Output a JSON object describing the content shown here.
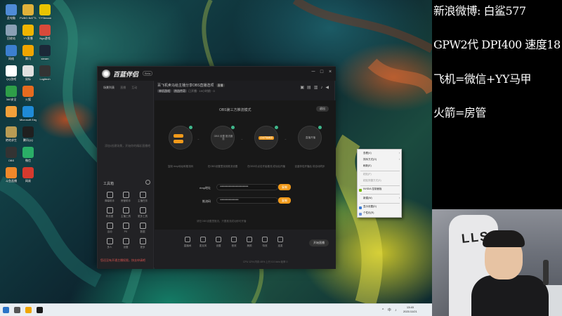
{
  "desktop_icons": [
    {
      "label": "此电脑",
      "color": "#4f8bd6"
    },
    {
      "label": "PUBG BATTLEGR",
      "color": "#e0b13a"
    },
    {
      "label": "YYStream",
      "color": "#e8c400"
    },
    {
      "label": "回收站",
      "color": "#8aa0b5"
    },
    {
      "label": "YY直播",
      "color": "#f0b400"
    },
    {
      "label": "Ngo游戏",
      "color": "#d84a3a"
    },
    {
      "label": "网络",
      "color": "#3c7fd0"
    },
    {
      "label": "腾讯",
      "color": "#f0a500"
    },
    {
      "label": "steam",
      "color": "#1b2838"
    },
    {
      "label": "QQ游戏",
      "color": "#ffffff"
    },
    {
      "label": "鼠标",
      "color": "#e0e0e0"
    },
    {
      "label": "Logitech",
      "color": "#333333"
    },
    {
      "label": "360安全",
      "color": "#2e9e48"
    },
    {
      "label": "火狐",
      "color": "#e66b1f"
    },
    {
      "label": "",
      "color": "#f2a03a"
    },
    {
      "label": "Microsoft Edge",
      "color": "#1f8ad6"
    },
    {
      "label": "绝地求生",
      "color": "#b89b54"
    },
    {
      "label": "腾讯QQ",
      "color": "#1f1f1f"
    },
    {
      "label": "OBS",
      "color": "#333333"
    },
    {
      "label": "微信",
      "color": "#2aae67"
    },
    {
      "label": "斗鱼直播",
      "color": "#f0882a"
    },
    {
      "label": "网易",
      "color": "#d63a2e"
    }
  ],
  "app": {
    "title": "百蓝伴侣",
    "badge": "Beta",
    "window_controls": [
      "─",
      "□",
      "×"
    ],
    "sidebar_tabs": [
      "场景列表",
      "直播",
      "互动"
    ],
    "sidebar_empty": "添加/创建场景，开始你的精彩直播吧",
    "tools_title": "工具箱",
    "tools": [
      {
        "label": "弹幕助手"
      },
      {
        "label": "房管助手"
      },
      {
        "label": "主播任务"
      },
      {
        "label": "粉丝团"
      },
      {
        "label": "主播工具"
      },
      {
        "label": "更多工具"
      },
      {
        "label": "活动"
      },
      {
        "label": "PK"
      },
      {
        "label": "数据"
      },
      {
        "label": "多人"
      },
      {
        "label": "设置"
      },
      {
        "label": "更多"
      }
    ],
    "notice": "您还没有开通主播权限，快去申请吧",
    "main_title": "百飞机卖马给主播分享OBS直播选项",
    "main_tag": "直播",
    "main_chips": [
      "单机游戏",
      "热血传奇"
    ],
    "main_meta": "已开播 · 19小时前 · 0",
    "canvas_title": "OBS第三方推流模式",
    "exit_label": "退出",
    "steps": [
      {
        "text": "",
        "caption": "复制 rtmp地址和推流码"
      },
      {
        "text": "OBS 设置 推流服务",
        "caption": "在OBS设置里找到推流设置"
      },
      {
        "text": "点击开始推流",
        "caption": "在OBS中点击开始推流 成功后开播"
      },
      {
        "text": "直播开播",
        "caption": "百蓝伴侣开播后 将自动同步"
      }
    ],
    "rtmp_label": "rtmp地址",
    "rtmp_value": "••••••••••••••••••••••••••••••••",
    "key_label": "推流码",
    "key_value": "•••••••••••••••••••••",
    "copy_label": "复制",
    "canvas_note": "请在OBS设置里推流，只要推流成功即可开播",
    "bottom_items": [
      "直播间",
      "麦克风",
      "设置",
      "音效",
      "美颜",
      "特效",
      "连麦"
    ],
    "start_label": "开始直播",
    "status_line": "CPU 12%  内存 45%  上行 0.0 kb/s  帧率 0"
  },
  "context_menu": {
    "items": [
      {
        "label": "查看(V)",
        "arrow": true
      },
      {
        "label": "排序方式(O)",
        "arrow": true
      },
      {
        "label": "刷新(E)",
        "arrow": false
      },
      {
        "label": "粘贴(P)",
        "arrow": false
      },
      {
        "label": "粘贴快捷方式(S)",
        "arrow": false
      },
      {
        "label": "NVIDIA 控制面板",
        "arrow": false
      },
      {
        "label": "新建(W)",
        "arrow": true
      },
      {
        "label": "显示设置(D)",
        "arrow": false
      },
      {
        "label": "个性化(R)",
        "arrow": false
      }
    ]
  },
  "taskbar": {
    "time": "13:45",
    "date": "2021/11/21",
    "tray": "^ 中 ♪"
  },
  "overlay": {
    "lines": [
      "新浪微博: 白鲨577",
      "GPW2代 DPI400 速度18",
      "飞机=微信+YY马甲",
      "火箭=房管"
    ]
  },
  "webcam": {
    "chair_text": "LLS"
  }
}
